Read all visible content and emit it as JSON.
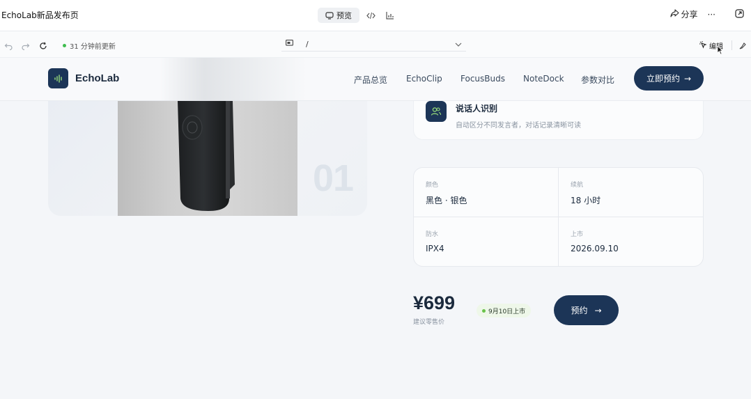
{
  "window": {
    "title": "EchoLab新品发布页",
    "preview_label": "预览",
    "share_label": "分享",
    "more_label": "···"
  },
  "addressbar": {
    "status_text": "31 分钟前更新",
    "url": "/",
    "edit_label": "编辑"
  },
  "site": {
    "brand": "EchoLab",
    "nav": [
      "产品总览",
      "EchoClip",
      "FocusBuds",
      "NoteDock",
      "参数对比"
    ],
    "cta_label": "立即预约",
    "cta_arrow": "→"
  },
  "product": {
    "index_number": "01"
  },
  "feature": {
    "title": "说话人识别",
    "description": "自动区分不同发言者，对话记录清晰可读",
    "icon": "users-icon"
  },
  "specs": [
    {
      "label": "颜色",
      "value": "黑色 · 银色"
    },
    {
      "label": "续航",
      "value": "18 小时"
    },
    {
      "label": "防水",
      "value": "IPX4"
    },
    {
      "label": "上市",
      "value": "2026.09.10"
    }
  ],
  "pricing": {
    "price": "¥699",
    "note": "建议零售价",
    "release": "9月10日上市",
    "button_label": "预约",
    "button_arrow": "→"
  },
  "colors": {
    "brand_navy": "#1c3557",
    "status_green": "#3fbd4f",
    "pill_bg": "#eef7e9"
  }
}
